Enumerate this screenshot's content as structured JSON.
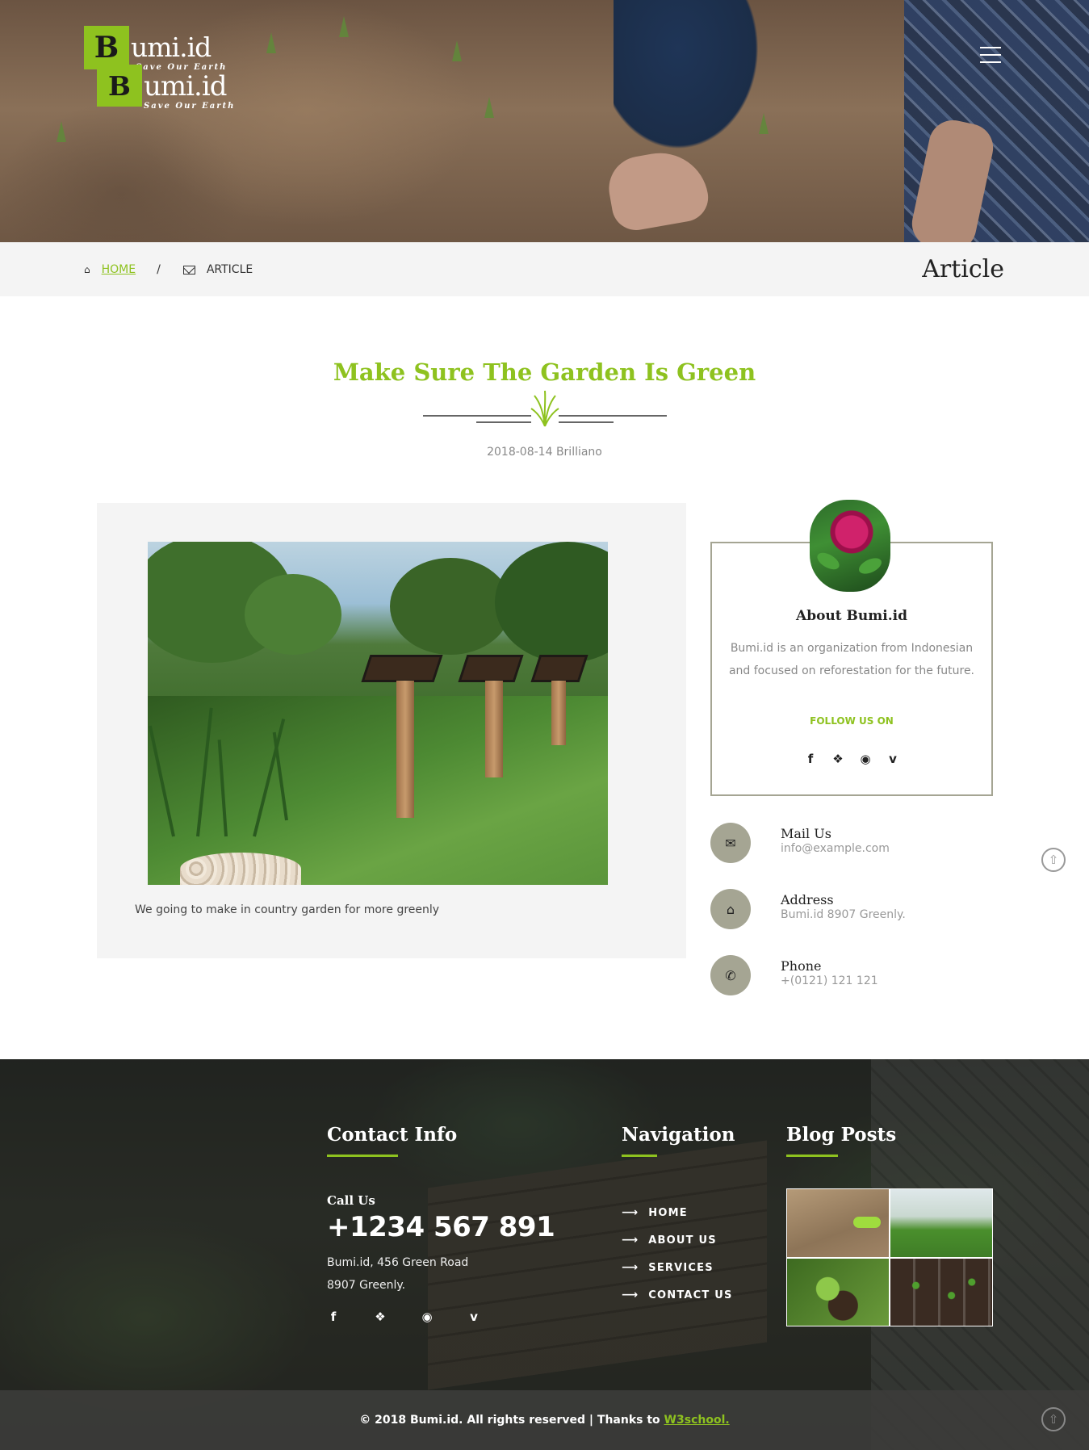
{
  "brand": {
    "logo_letter": "B",
    "logo_text": "umi.id",
    "tagline": "Save Our Earth"
  },
  "colors": {
    "accent": "#8ec21f",
    "sidebar_gray": "#a5a593",
    "card_bg": "#f4f4f4"
  },
  "breadcrumb": {
    "home_label": "HOME",
    "separator": "/",
    "current_label": "ARTICLE",
    "page_heading": "Article"
  },
  "article": {
    "title": "Make Sure The Garden Is Green",
    "date": "2018-08-14",
    "author": "Brilliano",
    "caption": "We going to make in country garden for more greenly"
  },
  "about": {
    "title": "About Bumi.id",
    "description": "Bumi.id is an organization from Indonesian and focused on reforestation for the future.",
    "follow_label": "FOLLOW US ON",
    "social_icons": [
      "facebook-icon",
      "twitter-icon",
      "dribbble-icon",
      "vimeo-icon"
    ]
  },
  "contact_items": [
    {
      "icon": "mail-icon",
      "label": "Mail Us",
      "value": "info@example.com"
    },
    {
      "icon": "home-icon",
      "label": "Address",
      "value": "Bumi.id 8907 Greenly."
    },
    {
      "icon": "phone-icon",
      "label": "Phone",
      "value": "+(0121) 121 121"
    }
  ],
  "footer": {
    "contact_heading": "Contact Info",
    "call_label": "Call Us",
    "call_number": "+1234 567 891",
    "address_line1": "Bumi.id, 456 Green Road",
    "address_line2": "8907 Greenly.",
    "nav_heading": "Navigation",
    "nav_items": [
      "HOME",
      "ABOUT US",
      "SERVICES",
      "CONTACT US"
    ],
    "blog_heading": "Blog Posts",
    "copyright_text": "© 2018 Bumi.id. All rights reserved | Thanks to",
    "credit_link": "W3school."
  }
}
